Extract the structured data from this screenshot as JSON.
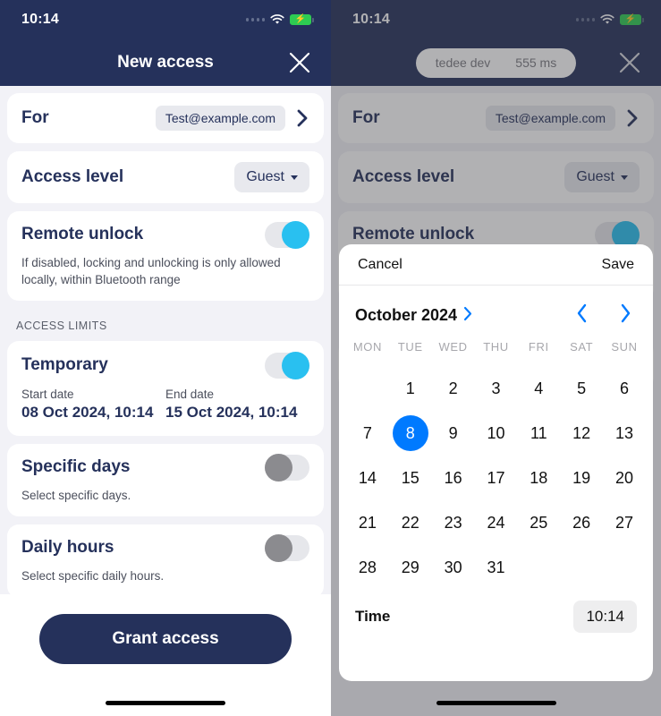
{
  "status_bar": {
    "time": "10:14",
    "wifi_icon": "wifi-icon",
    "battery_icon": "battery-charging-icon",
    "signal_icon": "signal-dots-icon"
  },
  "left_screen": {
    "nav": {
      "title": "New access",
      "close_icon": "close-icon"
    },
    "for_row": {
      "label": "For",
      "value": "Test@example.com",
      "chevron_icon": "chevron-right-icon"
    },
    "access_level_row": {
      "label": "Access level",
      "value": "Guest",
      "caret_icon": "chevron-down-icon"
    },
    "remote_unlock": {
      "label": "Remote unlock",
      "description": "If disabled, locking and unlocking is only allowed locally, within Bluetooth range",
      "toggle_state": "on"
    },
    "section_label": "ACCESS LIMITS",
    "temporary": {
      "label": "Temporary",
      "toggle_state": "on",
      "start_caption": "Start date",
      "start_value": "08 Oct 2024, 10:14",
      "end_caption": "End date",
      "end_value": "15 Oct 2024, 10:14"
    },
    "specific_days": {
      "label": "Specific days",
      "description": "Select specific days.",
      "toggle_state": "off"
    },
    "daily_hours": {
      "label": "Daily hours",
      "description": "Select specific daily hours.",
      "toggle_state": "off"
    },
    "grant_button": "Grant access"
  },
  "right_screen": {
    "nav": {
      "device_name": "tedee dev",
      "latency": "555 ms",
      "close_icon": "close-icon"
    },
    "modal": {
      "cancel": "Cancel",
      "save": "Save",
      "month_title": "October 2024",
      "month_expand_icon": "chevron-right-icon",
      "prev_icon": "chevron-left-icon",
      "next_icon": "chevron-right-icon",
      "weekdays": [
        "MON",
        "TUE",
        "WED",
        "THU",
        "FRI",
        "SAT",
        "SUN"
      ],
      "weeks": [
        [
          "",
          "1",
          "2",
          "3",
          "4",
          "5",
          "6"
        ],
        [
          "7",
          "8",
          "9",
          "10",
          "11",
          "12",
          "13"
        ],
        [
          "14",
          "15",
          "16",
          "17",
          "18",
          "19",
          "20"
        ],
        [
          "21",
          "22",
          "23",
          "24",
          "25",
          "26",
          "27"
        ],
        [
          "28",
          "29",
          "30",
          "31",
          "",
          "",
          ""
        ]
      ],
      "selected_day": "8",
      "time_label": "Time",
      "time_value": "10:14"
    }
  },
  "colors": {
    "navy": "#25315b",
    "cyan": "#29c0f0",
    "blue": "#007aff",
    "bg": "#f2f2f7"
  }
}
